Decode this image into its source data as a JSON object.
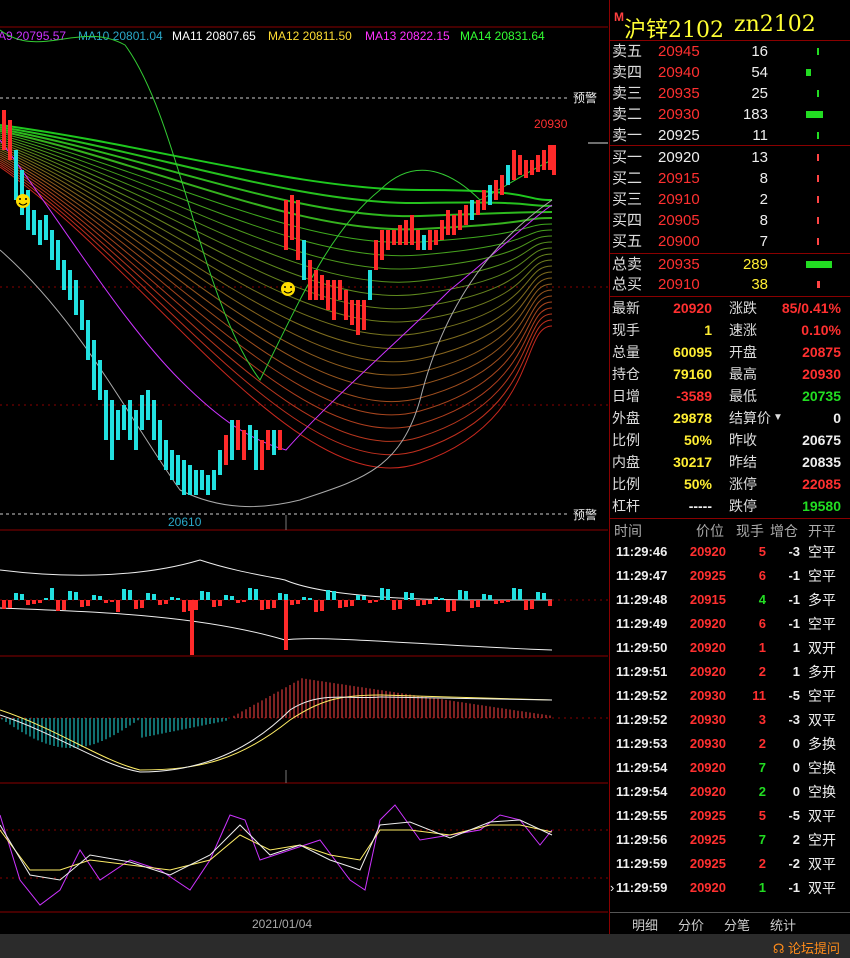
{
  "ma_legend": [
    {
      "label": "A9 20795.57",
      "color": "#cc33ff"
    },
    {
      "label": "MA10 20801.04",
      "color": "#2aa8c8"
    },
    {
      "label": "MA11 20807.65",
      "color": "#ffffff"
    },
    {
      "label": "MA12 20811.50",
      "color": "#ffdd33"
    },
    {
      "label": "MA13 20822.15",
      "color": "#ff33ff"
    },
    {
      "label": "MA14 20831.64",
      "color": "#33ff33"
    }
  ],
  "chart": {
    "warn_top": "预警",
    "warn_bottom": "预警",
    "high_label": "20930",
    "low_label": "20610",
    "date_label": "2021/01/04"
  },
  "quote": {
    "marker": "M",
    "name": "沪锌2102",
    "code": "zn2102",
    "asks": [
      {
        "label": "卖五",
        "price": "20945",
        "vol": "16",
        "bar": 0.01
      },
      {
        "label": "卖四",
        "price": "20940",
        "vol": "54",
        "bar": 0.03
      },
      {
        "label": "卖三",
        "price": "20935",
        "vol": "25",
        "bar": 0.015
      },
      {
        "label": "卖二",
        "price": "20930",
        "vol": "183",
        "bar": 0.11
      },
      {
        "label": "卖一",
        "price": "20925",
        "vol": "11",
        "bar": 0.006
      }
    ],
    "bids": [
      {
        "label": "买一",
        "price": "20920",
        "vol": "13",
        "bar": 0.008
      },
      {
        "label": "买二",
        "price": "20915",
        "vol": "8",
        "bar": 0.005
      },
      {
        "label": "买三",
        "price": "20910",
        "vol": "2",
        "bar": 0.001
      },
      {
        "label": "买四",
        "price": "20905",
        "vol": "8",
        "bar": 0.005
      },
      {
        "label": "买五",
        "price": "20900",
        "vol": "7",
        "bar": 0.004
      }
    ],
    "total_sell": {
      "label": "总卖",
      "price": "20935",
      "vol": "289",
      "bar": 0.17
    },
    "total_buy": {
      "label": "总买",
      "price": "20910",
      "vol": "38",
      "bar": 0.02
    }
  },
  "stats": [
    {
      "a": "最新",
      "b": "20920",
      "bc": "red",
      "c": "涨跌",
      "d": "85/0.41%",
      "dc": "red"
    },
    {
      "a": "现手",
      "b": "1",
      "bc": "yel",
      "c": "速涨",
      "d": "0.10%",
      "dc": "red"
    },
    {
      "a": "总量",
      "b": "60095",
      "bc": "yel",
      "c": "开盘",
      "d": "20875",
      "dc": "red"
    },
    {
      "a": "持仓",
      "b": "79160",
      "bc": "yel",
      "c": "最高",
      "d": "20930",
      "dc": "red"
    },
    {
      "a": "日增",
      "b": "-3589",
      "bc": "red",
      "c": "最低",
      "d": "20735",
      "dc": "grn"
    },
    {
      "a": "外盘",
      "b": "29878",
      "bc": "yel",
      "c": "结算价",
      "d": "0",
      "dc": "wht"
    },
    {
      "a": "比例",
      "b": "50%",
      "bc": "yel",
      "c": "昨收",
      "d": "20675",
      "dc": "wht"
    },
    {
      "a": "内盘",
      "b": "30217",
      "bc": "yel",
      "c": "昨结",
      "d": "20835",
      "dc": "wht"
    },
    {
      "a": "比例",
      "b": "50%",
      "bc": "yel",
      "c": "涨停",
      "d": "22085",
      "dc": "red"
    },
    {
      "a": "杠杆",
      "b": "-----",
      "bc": "wht",
      "c": "跌停",
      "d": "19580",
      "dc": "grn"
    }
  ],
  "ticks_header": {
    "time": "时间",
    "price": "价位",
    "qty": "现手",
    "oi": "增仓",
    "kp": "开平"
  },
  "ticks": [
    {
      "time": "11:29:46",
      "price": "20920",
      "qty": "5",
      "qc": "red",
      "oi": "-3",
      "kp": "空平"
    },
    {
      "time": "11:29:47",
      "price": "20925",
      "qty": "6",
      "qc": "red",
      "oi": "-1",
      "kp": "空平"
    },
    {
      "time": "11:29:48",
      "price": "20915",
      "qty": "4",
      "qc": "grn",
      "oi": "-1",
      "kp": "多平"
    },
    {
      "time": "11:29:49",
      "price": "20920",
      "qty": "6",
      "qc": "red",
      "oi": "-1",
      "kp": "空平"
    },
    {
      "time": "11:29:50",
      "price": "20920",
      "qty": "1",
      "qc": "red",
      "oi": "1",
      "kp": "双开"
    },
    {
      "time": "11:29:51",
      "price": "20920",
      "qty": "2",
      "qc": "red",
      "oi": "1",
      "kp": "多开"
    },
    {
      "time": "11:29:52",
      "price": "20930",
      "qty": "11",
      "qc": "red",
      "oi": "-5",
      "kp": "空平"
    },
    {
      "time": "11:29:52",
      "price": "20930",
      "qty": "3",
      "qc": "red",
      "oi": "-3",
      "kp": "双平"
    },
    {
      "time": "11:29:53",
      "price": "20930",
      "qty": "2",
      "qc": "red",
      "oi": "0",
      "kp": "多换"
    },
    {
      "time": "11:29:54",
      "price": "20920",
      "qty": "7",
      "qc": "grn",
      "oi": "0",
      "kp": "空换"
    },
    {
      "time": "11:29:54",
      "price": "20920",
      "qty": "2",
      "qc": "grn",
      "oi": "0",
      "kp": "空换"
    },
    {
      "time": "11:29:55",
      "price": "20925",
      "qty": "5",
      "qc": "red",
      "oi": "-5",
      "kp": "双平"
    },
    {
      "time": "11:29:56",
      "price": "20925",
      "qty": "7",
      "qc": "grn",
      "oi": "2",
      "kp": "空开"
    },
    {
      "time": "11:29:59",
      "price": "20925",
      "qty": "2",
      "qc": "red",
      "oi": "-2",
      "kp": "双平"
    },
    {
      "time": "11:29:59",
      "price": "20920",
      "qty": "1",
      "qc": "grn",
      "oi": "-1",
      "kp": "双平"
    }
  ],
  "tabs": [
    "明细",
    "分价",
    "分笔",
    "统计"
  ],
  "forum_link": "论坛提问"
}
